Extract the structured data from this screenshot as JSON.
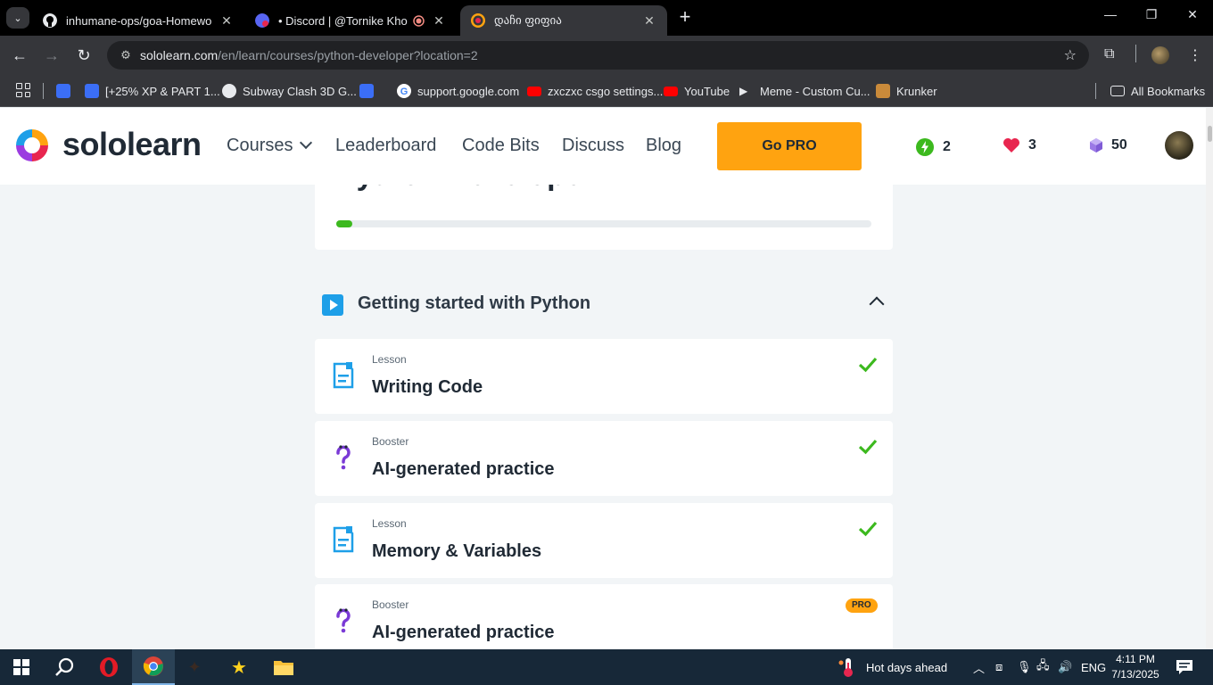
{
  "browser": {
    "tabs": [
      {
        "title": "inhumane-ops/goa-Homework",
        "favicon": "github-icon",
        "active": false
      },
      {
        "title": "• Discord | @Tornike Khozre",
        "favicon": "discord-icon",
        "active": false
      },
      {
        "title": "დაჩი ფიფია",
        "favicon": "sololearn-icon",
        "active": true
      }
    ],
    "url_host": "sololearn.com",
    "url_path": "/en/learn/courses/python-developer?location=2",
    "bookmarks": [
      {
        "label": "",
        "icon": "roblox-icon"
      },
      {
        "label": "[+25% XP & PART 1...",
        "icon": "roblox-icon"
      },
      {
        "label": "Subway Clash 3D G...",
        "icon": "globe-icon"
      },
      {
        "label": "",
        "icon": "roblox-icon"
      },
      {
        "label": "support.google.com",
        "icon": "google-icon"
      },
      {
        "label": "zxczxc csgo settings...",
        "icon": "youtube-icon"
      },
      {
        "label": "YouTube",
        "icon": "youtube-icon"
      },
      {
        "label": "Meme - Custom Cu...",
        "icon": "cursor-icon"
      },
      {
        "label": "Krunker",
        "icon": "krunker-icon"
      }
    ],
    "all_bookmarks": "All Bookmarks"
  },
  "header": {
    "brand": "sololearn",
    "nav": [
      "Courses",
      "Leaderboard",
      "Code Bits",
      "Discuss",
      "Blog"
    ],
    "go_pro": "Go PRO",
    "streak": "2",
    "hearts": "3",
    "gems": "50"
  },
  "course": {
    "title": "Python Developer",
    "progress_percent": 3
  },
  "module": {
    "title": "Getting started with Python"
  },
  "lessons": [
    {
      "type": "Lesson",
      "name": "Writing Code",
      "status": "completed",
      "icon": "document-icon"
    },
    {
      "type": "Booster",
      "name": "AI-generated practice",
      "status": "completed",
      "icon": "question-mark-icon"
    },
    {
      "type": "Lesson",
      "name": "Memory & Variables",
      "status": "completed",
      "icon": "document-icon"
    },
    {
      "type": "Booster",
      "name": "AI-generated practice",
      "status": "pro",
      "badge": "PRO",
      "icon": "question-mark-icon"
    }
  ],
  "taskbar": {
    "weather": "Hot days ahead",
    "language": "ENG",
    "time": "4:11 PM",
    "date": "7/13/2025"
  },
  "colors": {
    "accent_orange": "#ffa310",
    "check_green": "#3cb91e",
    "heart": "#e8264f",
    "gem": "#9b79e6",
    "streak": "#3cb91e",
    "play_blue": "#1e9fe8"
  }
}
